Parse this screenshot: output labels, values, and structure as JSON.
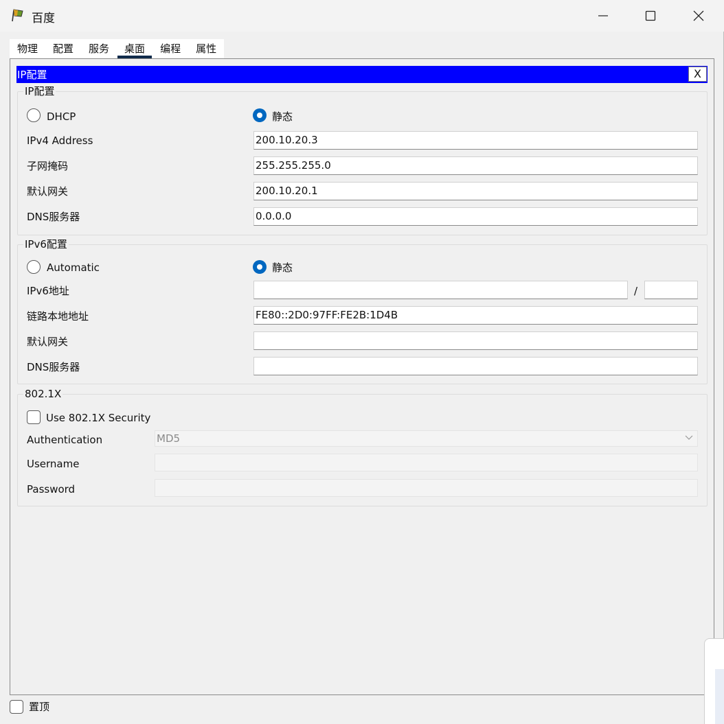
{
  "window": {
    "title": "百度"
  },
  "tabs": [
    {
      "label": "物理"
    },
    {
      "label": "配置"
    },
    {
      "label": "服务"
    },
    {
      "label": "桌面",
      "active": true
    },
    {
      "label": "编程"
    },
    {
      "label": "属性"
    }
  ],
  "ip_panel": {
    "title": "IP配置",
    "close_label": "X"
  },
  "ipv4": {
    "group_title": "IP配置",
    "dhcp_label": "DHCP",
    "static_label": "静态",
    "mode": "static",
    "address_label": "IPv4 Address",
    "address_value": "200.10.20.3",
    "mask_label": "子网掩码",
    "mask_value": "255.255.255.0",
    "gateway_label": "默认网关",
    "gateway_value": "200.10.20.1",
    "dns_label": "DNS服务器",
    "dns_value": "0.0.0.0"
  },
  "ipv6": {
    "group_title": "IPv6配置",
    "auto_label": "Automatic",
    "static_label": "静态",
    "mode": "static",
    "address_label": "IPv6地址",
    "address_value": "",
    "prefix_separator": "/",
    "prefix_value": "",
    "link_local_label": "链路本地地址",
    "link_local_value": "FE80::2D0:97FF:FE2B:1D4B",
    "gateway_label": "默认网关",
    "gateway_value": "",
    "dns_label": "DNS服务器",
    "dns_value": ""
  },
  "dot1x": {
    "group_title": "802.1X",
    "use_security_label": "Use 802.1X Security",
    "use_security_checked": false,
    "auth_label": "Authentication",
    "auth_value": "MD5",
    "username_label": "Username",
    "username_value": "",
    "password_label": "Password",
    "password_value": ""
  },
  "footer": {
    "pin_label": "置顶",
    "pin_checked": false
  },
  "colors": {
    "header_blue": "#0000ff",
    "radio_selected": "#0067c0",
    "active_tab_underline": "#0f2a4a"
  }
}
